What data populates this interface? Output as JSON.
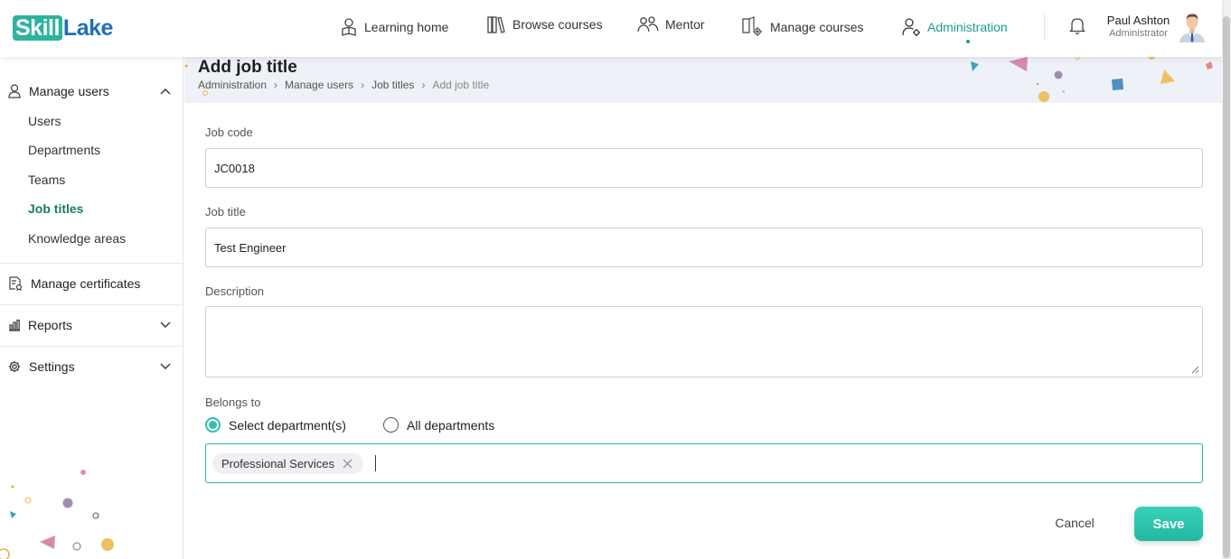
{
  "header": {
    "logo_part1": "Skill",
    "logo_part2": "Lake",
    "nav": [
      {
        "label": "Learning home",
        "icon": "learning-home-icon"
      },
      {
        "label": "Browse courses",
        "icon": "books-icon"
      },
      {
        "label": "Mentor",
        "icon": "mentor-icon"
      },
      {
        "label": "Manage courses",
        "icon": "manage-courses-icon"
      },
      {
        "label": "Administration",
        "icon": "admin-user-gear-icon",
        "active": true
      }
    ],
    "user": {
      "name": "Paul Ashton",
      "role": "Administrator"
    }
  },
  "sidebar": {
    "manage_users": {
      "label": "Manage users",
      "items": [
        {
          "label": "Users"
        },
        {
          "label": "Departments"
        },
        {
          "label": "Teams"
        },
        {
          "label": "Job titles",
          "active": true
        },
        {
          "label": "Knowledge areas"
        }
      ]
    },
    "manage_certificates": {
      "label": "Manage certificates"
    },
    "reports": {
      "label": "Reports"
    },
    "settings": {
      "label": "Settings"
    }
  },
  "page": {
    "title": "Add job title",
    "breadcrumbs": [
      "Administration",
      "Manage users",
      "Job titles",
      "Add job title"
    ]
  },
  "form": {
    "job_code": {
      "label": "Job code",
      "value": "JC0018"
    },
    "job_title": {
      "label": "Job title",
      "value": "Test Engineer"
    },
    "description": {
      "label": "Description",
      "value": ""
    },
    "belongs_to": {
      "label": "Belongs to",
      "options": [
        "Select department(s)",
        "All departments"
      ],
      "selected": "Select department(s)"
    },
    "departments": {
      "chips": [
        "Professional Services"
      ]
    },
    "cancel_label": "Cancel",
    "save_label": "Save"
  },
  "colors": {
    "accent": "#2fc1ab",
    "active_text": "#1aa08a",
    "brand_blue": "#1f6fb4"
  }
}
